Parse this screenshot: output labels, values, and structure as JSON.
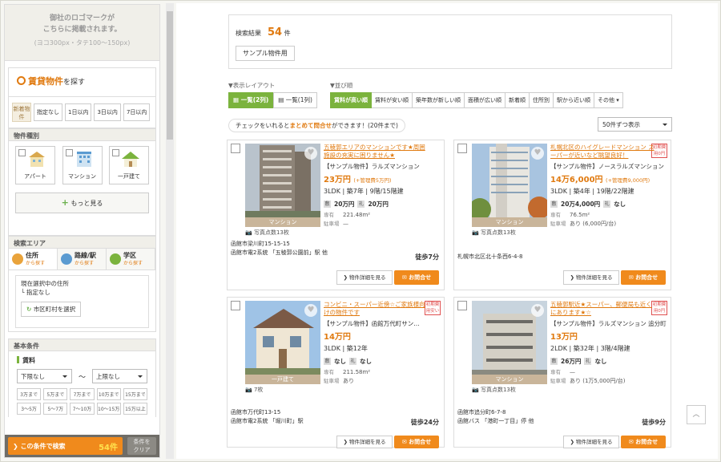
{
  "sidebar": {
    "logo_line1": "御社のロゴマークが",
    "logo_line2": "こちらに掲載されます。",
    "logo_size": "(ヨコ300px・タテ100〜150px)",
    "search_title": "賃貸物件",
    "search_title_rest": "を探す",
    "new_tag": "新着物件",
    "new_options": [
      "指定なし",
      "1日以内",
      "3日以内",
      "7日以内"
    ],
    "types_title": "物件種別",
    "types": [
      "アパート",
      "マンション",
      "一戸建て"
    ],
    "more_label": "もっと見る",
    "area_title": "検索エリア",
    "area_tabs": [
      {
        "label": "住所",
        "sub": "から探す"
      },
      {
        "label": "路線/駅",
        "sub": "から探す"
      },
      {
        "label": "学区",
        "sub": "から探す"
      }
    ],
    "current_label": "現在選択中の住所",
    "current_value": "└ 指定なし",
    "city_button": "市区町村を選択",
    "cond_title": "基本条件",
    "rent_label": "賃料",
    "rent_min": "下限なし",
    "rent_sep": "〜",
    "rent_max": "上限なし",
    "quick": [
      "3万まで",
      "5万まで",
      "7万まで",
      "10万まで",
      "15万まで",
      "3〜5万",
      "5〜7万",
      "7〜10万",
      "10〜15万",
      "15万以上"
    ],
    "search_btn": "この条件で検索",
    "search_count": "54件",
    "clear_btn_1": "条件を",
    "clear_btn_2": "クリア"
  },
  "main": {
    "result_label": "検索結果",
    "result_count": "54",
    "result_unit": "件",
    "sample_tag": "サンプル物件用",
    "layout_label": "▼表示レイアウト",
    "sort_label": "▼並び順",
    "layout_buttons": [
      "一覧(2列)",
      "一覧(1列)"
    ],
    "sort_buttons": [
      "賃料が高い順",
      "賃料が安い順",
      "築年数が新しい順",
      "面積が広い順",
      "新着順",
      "住所別",
      "駅から近い順",
      "その他"
    ],
    "info_pre": "チェックをいれると",
    "info_bold": "まとめて問合せ",
    "info_post": "ができます！(20件まで)",
    "per_page": "50件ずつ表示"
  },
  "cards": [
    {
      "title": "五稜郭エリアのマンションです★周囲施設の充実に困りません★",
      "badge": "",
      "name": "【サンプル物件】ラルズマンション",
      "price": "23万円",
      "kanri": "(+管理費5万円)",
      "spec": "3LDK | 築7年 | 9階/15階建",
      "deposit": "20万円",
      "key": "20万円",
      "area_label": "専有",
      "area": "221.48m²",
      "parking_label": "駐車場",
      "parking": "—",
      "photo_tag": "マンション",
      "photo_cnt": "写真点数13枚",
      "addr1": "函館市梁川町15-15-15",
      "addr2": "函館市電2系統 「五稜郭公園前」駅 他",
      "walk": "徒歩7分",
      "detail": "物件詳細を見る",
      "inquiry": "お問合せ"
    },
    {
      "title": "札幌北区のハイグレードマンション スーパーが近いなど眺望良好！",
      "badge": "初期費用0円",
      "name": "【サンプル物件】ノースラルズマンション",
      "price": "14万6,000円",
      "kanri": "(+管理費9,000円)",
      "spec": "3LDK | 築4年 | 19階/22階建",
      "deposit": "20万4,000円",
      "key": "なし",
      "area_label": "専有",
      "area": "76.5m²",
      "parking_label": "駐車場",
      "parking": "あり (6,000円/台)",
      "photo_tag": "マンション",
      "photo_cnt": "写真点数13枚",
      "addr1": "札幌市北区北十条西6-4-8",
      "addr2": "",
      "walk": "",
      "detail": "物件詳細を見る",
      "inquiry": "お問合せ"
    },
    {
      "title": "コンビニ・スーパー近傍☆ご家族様向けの物件です",
      "badge": "初期費用安い",
      "name": "【サンプル物件】函館万代町サン…",
      "price": "14万円",
      "kanri": "",
      "spec": "3LDK | 築12年",
      "deposit": "なし",
      "key": "なし",
      "area_label": "専有",
      "area": "211.58m²",
      "parking_label": "駐車場",
      "parking": "あり",
      "photo_tag": "一戸建て",
      "photo_cnt": "7枚",
      "addr1": "函館市万代町13-15",
      "addr2": "函館市電2系統 「堀川町」駅",
      "walk": "徒歩24分",
      "detail": "物件詳細を見る",
      "inquiry": "お問合せ"
    },
    {
      "title": "五稜郭駅近★スーパー、郵便局も近くにあります★☆",
      "badge": "初期費用0円",
      "name": "【サンプル物件】ラルズマンション 追分町",
      "price": "13万円",
      "kanri": "",
      "spec": "2LDK | 築32年 | 3階/4階建",
      "deposit": "26万円",
      "key": "なし",
      "area_label": "専有",
      "area": "—",
      "parking_label": "駐車場",
      "parking": "あり (1万5,000円/台)",
      "photo_tag": "マンション",
      "photo_cnt": "写真点数13枚",
      "addr1": "函館市追分町6-7-8",
      "addr2": "函館バス 「港町一丁目」停 他",
      "walk": "徒歩9分",
      "detail": "物件詳細を見る",
      "inquiry": "お問合せ"
    }
  ],
  "totop": "︿"
}
